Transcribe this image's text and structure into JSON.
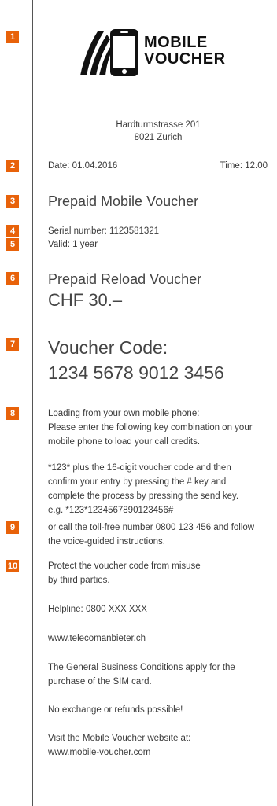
{
  "markers": [
    "1",
    "2",
    "3",
    "4",
    "5",
    "6",
    "7",
    "8",
    "9",
    "10"
  ],
  "logo": {
    "line1": "MOBILE",
    "line2": "VOUCHER"
  },
  "address": {
    "street": "Hardturmstrasse 201",
    "city": "8021 Zurich"
  },
  "date": "Date: 01.04.2016",
  "time": "Time: 12.00",
  "title": "Prepaid Mobile Voucher",
  "serial": "Serial number: 1123581321",
  "valid": "Valid: 1 year",
  "reload": {
    "label": "Prepaid Reload Voucher",
    "amount": "CHF 30.–"
  },
  "code": {
    "label": "Voucher Code:",
    "value": "1234 5678 9012 3456"
  },
  "loading": [
    "Loading from your own mobile phone:",
    "Please enter the following key combination on your",
    "mobile phone to load your call credits."
  ],
  "instructions": [
    "*123* plus the 16-digit voucher code and then",
    "confirm your entry by pressing the # key and",
    "complete the process by pressing the send key.",
    "e.g. *123*1234567890123456#"
  ],
  "tollfree": [
    "or call the toll-free number 0800 123 456 and follow",
    "the voice-guided instructions."
  ],
  "protect": [
    "Protect the voucher code from misuse",
    "by third parties."
  ],
  "helpline": "Helpline: 0800 XXX XXX",
  "website": "www.telecomanbieter.ch",
  "conditions": [
    "The General Business Conditions apply for the",
    "purchase of the SIM card."
  ],
  "noexchange": "No exchange or refunds possible!",
  "visit": [
    "Visit the Mobile Voucher website at:",
    "www.mobile-voucher.com"
  ],
  "colors": {
    "marker": "#e8620a",
    "text": "#333333"
  },
  "icons": [
    "phone-logo-icon"
  ]
}
